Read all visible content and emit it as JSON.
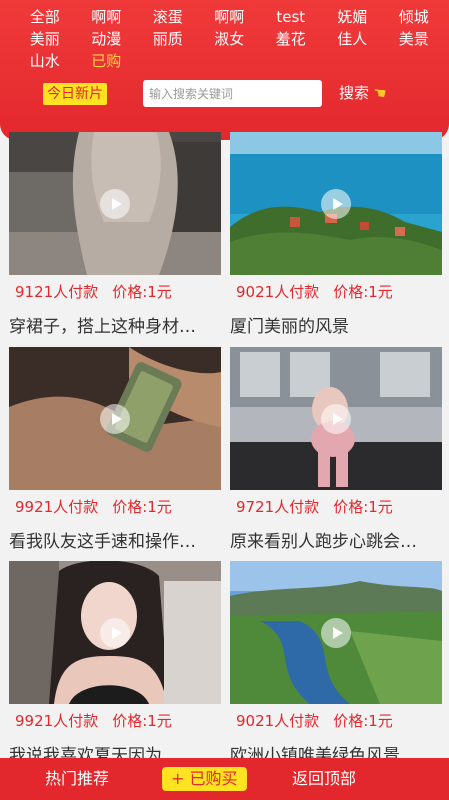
{
  "header": {
    "categories": [
      "全部",
      "啊啊",
      "滚蛋",
      "啊啊",
      "test",
      "妩媚",
      "倾城",
      "美丽",
      "动漫",
      "丽质",
      "淑女",
      "羞花",
      "佳人",
      "美景",
      "山水",
      "已购"
    ],
    "active_category": 15,
    "today_label": "今日新片",
    "search_placeholder": "输入搜索关键词",
    "search_button": "搜索",
    "search_icon": "pointing-hand-icon"
  },
  "videos": [
    {
      "paid": "9121人付款",
      "price": "价格:1元",
      "title": "穿裙子，搭上这种身材…",
      "thumb": "woman-skirt"
    },
    {
      "paid": "9021人付款",
      "price": "价格:1元",
      "title": "厦门美丽的风景",
      "thumb": "coast-island"
    },
    {
      "paid": "9921人付款",
      "price": "价格:1元",
      "title": "看我队友这手速和操作…",
      "thumb": "phone-hands"
    },
    {
      "paid": "9721人付款",
      "price": "价格:1元",
      "title": "原来看别人跑步心跳会…",
      "thumb": "treadmill"
    },
    {
      "paid": "9921人付款",
      "price": "价格:1元",
      "title": "我说我喜欢夏天因为…",
      "thumb": "girl-portrait"
    },
    {
      "paid": "9021人付款",
      "price": "价格:1元",
      "title": "欧洲小镇唯美绿色风景…",
      "thumb": "river-valley"
    }
  ],
  "footer": {
    "hot": "热门推荐",
    "bought": "+ 已购买",
    "top": "返回顶部"
  },
  "colors": {
    "primary": "#e3282d",
    "accent": "#ffe321",
    "active": "#ffd44a"
  }
}
